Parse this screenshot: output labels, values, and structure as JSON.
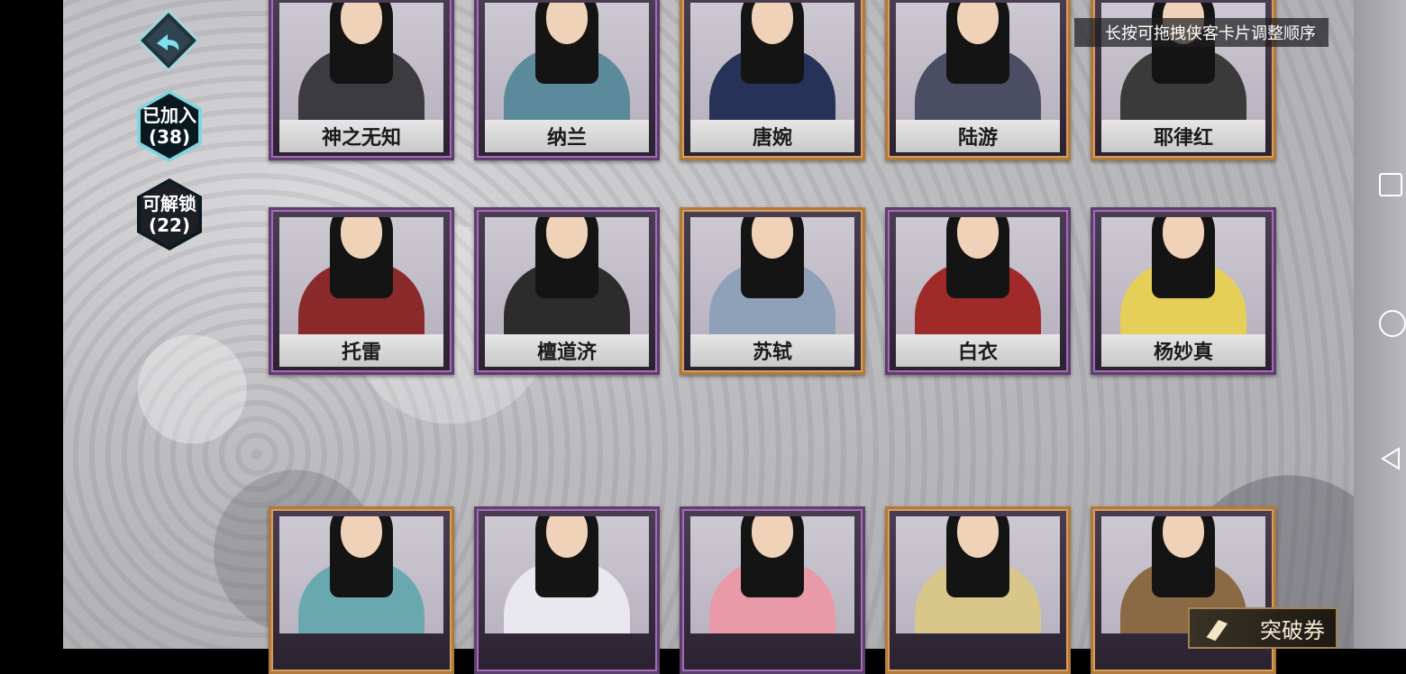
{
  "hint": "长按可拖拽侠客卡片调整顺序",
  "filters": {
    "joined_label": "已加入",
    "joined_count": "(38)",
    "unlockable_label": "可解锁",
    "unlockable_count": "(22)"
  },
  "ticket_label": "突破券",
  "rows": [
    [
      {
        "name": "神之无知",
        "robe": "#3b3b40"
      },
      {
        "name": "纳兰",
        "robe": "#5b8a9a"
      },
      {
        "name": "唐婉",
        "robe": "#263257"
      },
      {
        "name": "陆游",
        "robe": "#4a4d63"
      },
      {
        "name": "耶律红",
        "robe": "#3a3a3a"
      }
    ],
    [
      {
        "name": "托雷",
        "robe": "#8a2a2a"
      },
      {
        "name": "檀道济",
        "robe": "#2c2c2c"
      },
      {
        "name": "苏轼",
        "robe": "#8ea1b8"
      },
      {
        "name": "白衣",
        "robe": "#a02a2a"
      },
      {
        "name": "杨妙真",
        "robe": "#e6cf59"
      }
    ],
    [
      {
        "name": "",
        "robe": "#6aa8b0"
      },
      {
        "name": "",
        "robe": "#e8e8ee"
      },
      {
        "name": "",
        "robe": "#e89aa8"
      },
      {
        "name": "",
        "robe": "#d8c68a"
      },
      {
        "name": "",
        "robe": "#8a6a44"
      }
    ]
  ]
}
